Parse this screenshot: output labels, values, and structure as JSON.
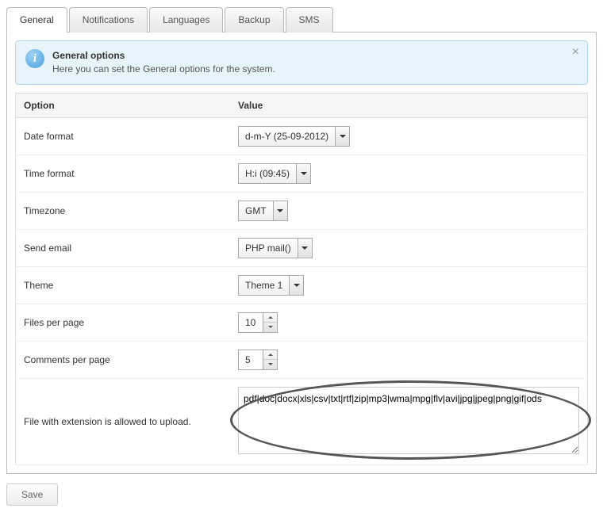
{
  "tabs": [
    {
      "label": "General",
      "active": true
    },
    {
      "label": "Notifications",
      "active": false
    },
    {
      "label": "Languages",
      "active": false
    },
    {
      "label": "Backup",
      "active": false
    },
    {
      "label": "SMS",
      "active": false
    }
  ],
  "notice": {
    "title": "General options",
    "desc": "Here you can set the General options for the system."
  },
  "table": {
    "header_option": "Option",
    "header_value": "Value"
  },
  "rows": {
    "date_format": {
      "label": "Date format",
      "value": "d-m-Y (25-09-2012)"
    },
    "time_format": {
      "label": "Time format",
      "value": "H:i (09:45)"
    },
    "timezone": {
      "label": "Timezone",
      "value": "GMT"
    },
    "send_email": {
      "label": "Send email",
      "value": "PHP mail()"
    },
    "theme": {
      "label": "Theme",
      "value": "Theme 1"
    },
    "files_per_page": {
      "label": "Files per page",
      "value": "10"
    },
    "comments_per_page": {
      "label": "Comments per page",
      "value": "5"
    },
    "allowed_ext": {
      "label": "File with extension is allowed to upload.",
      "value": "pdf|doc|docx|xls|csv|txt|rtf|zip|mp3|wma|mpg|flv|avi|jpg|jpeg|png|gif|ods"
    }
  },
  "buttons": {
    "save": "Save"
  }
}
